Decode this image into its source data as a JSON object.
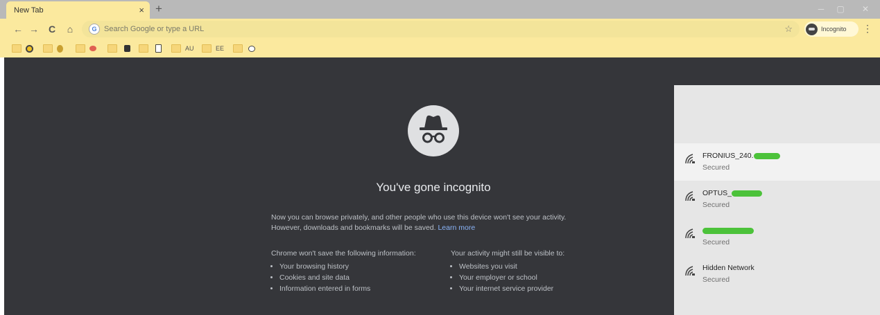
{
  "browser": {
    "tab_title": "New Tab",
    "tab_close": "×",
    "new_tab": "+",
    "window_controls": {
      "minimize": "─",
      "maximize": "▢",
      "close": "✕"
    },
    "toolbar": {
      "back": "←",
      "forward": "→",
      "reload": "C",
      "home": "⌂",
      "search_engine_badge": "G",
      "omnibox_placeholder": "Search Google or type a URL",
      "bookmark_star": "☆",
      "profile_label": "Incognito",
      "menu": "⋮"
    },
    "bookmarks_bar": [
      {
        "icon": "circle-icon",
        "label": ""
      },
      {
        "icon": "owl-icon",
        "label": ""
      },
      {
        "icon": "chat-icon",
        "label": ""
      },
      {
        "icon": "briefcase-icon",
        "label": ""
      },
      {
        "icon": "document-icon",
        "label": ""
      },
      {
        "icon": "text-icon",
        "label": "AU"
      },
      {
        "icon": "text-icon",
        "label": "EE"
      },
      {
        "icon": "chat-icon",
        "label": ""
      }
    ]
  },
  "incognito_page": {
    "title": "You've gone incognito",
    "intro_line1": "Now you can browse privately, and other people who use this device won't see your activity.",
    "intro_line2": "However, downloads and bookmarks will be saved.",
    "learn_more": "Learn more",
    "not_saved": {
      "heading": "Chrome won't save the following information:",
      "items": [
        "Your browsing history",
        "Cookies and site data",
        "Information entered in forms"
      ]
    },
    "visible_to": {
      "heading": "Your activity might still be visible to:",
      "items": [
        "Websites you visit",
        "Your employer or school",
        "Your internet service provider"
      ]
    }
  },
  "wifi_panel": {
    "networks": [
      {
        "name": "FRONIUS_240.",
        "status": "Secured",
        "selected": true
      },
      {
        "name": "OPTUS_",
        "status": "Secured",
        "selected": false
      },
      {
        "name": "",
        "status": "Secured",
        "selected": false
      },
      {
        "name": "Hidden Network",
        "status": "Secured",
        "selected": false
      }
    ]
  },
  "colors": {
    "chrome_yellow": "#fbe99e",
    "incognito_bg": "#35363a",
    "link": "#8ab4f8",
    "redaction": "#4cc23a"
  }
}
